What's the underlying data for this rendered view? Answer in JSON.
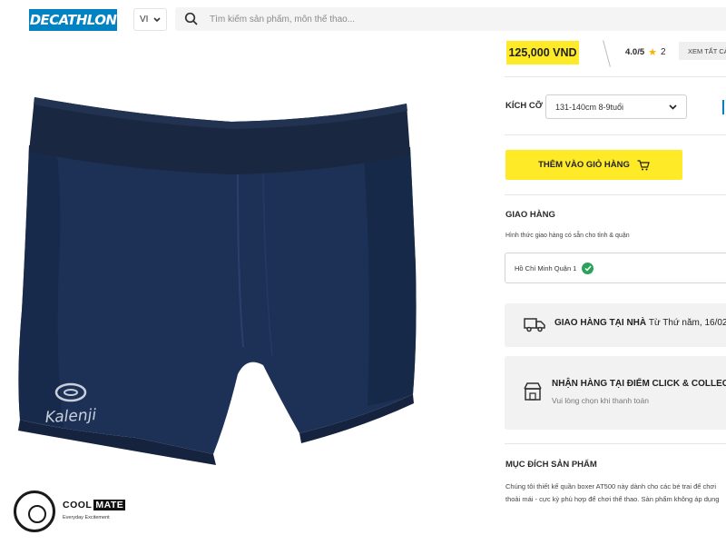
{
  "header": {
    "logo_text": "DECATHLON",
    "lang": "VI",
    "search_placeholder": "Tìm kiếm sản phẩm, môn thể thao..."
  },
  "product": {
    "brand_mark": "Kalenji",
    "price": "125,000 VND",
    "rating_score": "4.0/5",
    "rating_count": "2",
    "see_all": "XEM TẤT CẢ",
    "size_label": "KÍCH CỠ",
    "size_value": "131-140cm 8-9tuổi",
    "add_to_cart": "THÊM VÀO GIỎ HÀNG"
  },
  "shipping": {
    "title": "GIAO HÀNG",
    "note": "Hình thức giao hàng có sẵn cho tỉnh & quận",
    "location": "Hồ Chí Minh Quận 1",
    "home_delivery_bold": "GIAO HÀNG TẠI NHÀ",
    "home_delivery_date": "Từ Thứ năm, 16/02",
    "click_collect_title": "NHẬN HÀNG TẠI ĐIỂM CLICK & COLLECT TỪ",
    "click_collect_sub": "Vui lòng chọn khi thanh toán"
  },
  "purpose": {
    "title": "MỤC ĐÍCH SẢN PHẨM",
    "line1": "Chúng tôi thiết kế quần boxer AT500 này dành cho các bé trai để chơi",
    "line2": "thoải mái - cực kỳ phù hợp để chơi thể thao. Sản phẩm không áp dụng"
  },
  "watermark": {
    "cool": "COOL",
    "mate": "MATE",
    "tagline": "Everyday Excitement"
  },
  "colors": {
    "brand_blue": "#0082c3",
    "accent_yellow": "#ffea28",
    "product_navy": "#1b2f55",
    "check_green": "#29a359"
  }
}
